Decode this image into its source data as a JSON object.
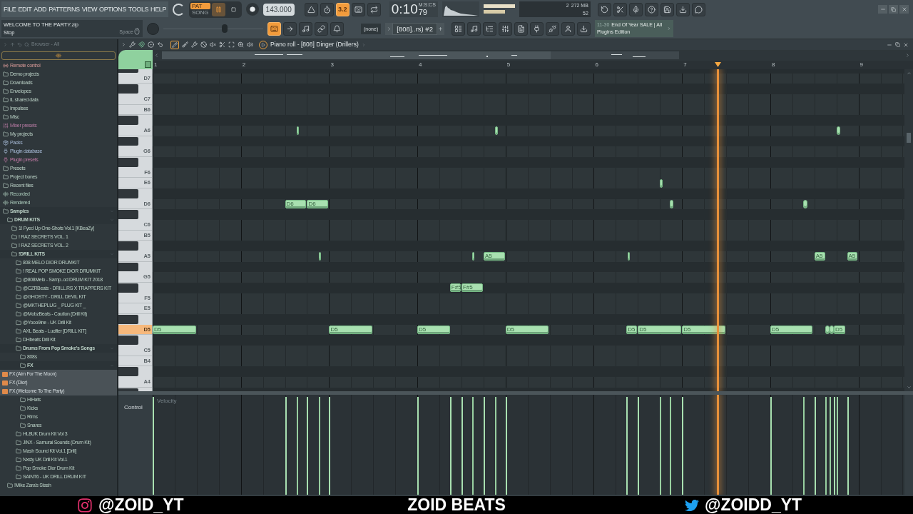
{
  "menu": [
    "FILE",
    "EDIT",
    "ADD",
    "PATTERNS",
    "VIEW",
    "OPTIONS",
    "TOOLS",
    "HELP"
  ],
  "modes": [
    {
      "label": "PAT",
      "selected": true
    },
    {
      "label": "SONG",
      "selected": false
    }
  ],
  "tempo": "143.000",
  "record_toggles": [
    {
      "on": false
    },
    {
      "on": false
    },
    {
      "on": true,
      "label": "3.2"
    },
    {
      "on": false
    },
    {
      "on": false
    }
  ],
  "time": {
    "value": "0:10",
    "centis": "79",
    "unit": "M:S:CS"
  },
  "stats": {
    "cpu": "2",
    "memory": "272 MB",
    "polyphony": "52"
  },
  "hint": {
    "title": "WELCOME TO THE PARTY.zip",
    "text": "Stop",
    "shortcut": "Space"
  },
  "master_pitch": {
    "level": 0.62
  },
  "edit_toggles": [
    {
      "on": true
    },
    {
      "on": false
    },
    {
      "on": false
    },
    {
      "on": false
    },
    {
      "on": false
    }
  ],
  "pattern_dropdown": "(none)",
  "pattern": "[808]..rs) #2",
  "news": {
    "date": "11-30",
    "text": "End Of Year SALE | All Plugins Edition"
  },
  "browser": {
    "title": "Browser - All",
    "items": [
      {
        "label": "Remote control",
        "kind": "remote"
      },
      {
        "label": "Demo projects",
        "kind": "folder",
        "expanded": false
      },
      {
        "label": "Downloads",
        "kind": "folder",
        "expanded": false
      },
      {
        "label": "Envelopes",
        "kind": "folder",
        "expanded": false
      },
      {
        "label": "IL shared data",
        "kind": "folder",
        "expanded": false
      },
      {
        "label": "Impulses",
        "kind": "folder",
        "expanded": false
      },
      {
        "label": "Misc",
        "kind": "folder",
        "expanded": false
      },
      {
        "label": "Mixer presets",
        "kind": "mixer"
      },
      {
        "label": "My projects",
        "kind": "folder",
        "expanded": false
      },
      {
        "label": "Packs",
        "kind": "packs"
      },
      {
        "label": "Plugin database",
        "kind": "plugin"
      },
      {
        "label": "Plugin presets",
        "kind": "presets"
      },
      {
        "label": "Presets",
        "kind": "folder",
        "expanded": false
      },
      {
        "label": "Project bones",
        "kind": "folder",
        "expanded": false
      },
      {
        "label": "Recent files",
        "kind": "folder",
        "expanded": false
      },
      {
        "label": "Recorded",
        "kind": "recorded"
      },
      {
        "label": "Rendered",
        "kind": "recorded"
      },
      {
        "label": "Samples",
        "kind": "folder",
        "expanded": true,
        "children": [
          {
            "label": "DRUM KITS",
            "kind": "folder",
            "expanded": true,
            "children": [
              {
                "label": "1! Fyed Up One-Shots Vol.1 [KBeaZy]",
                "kind": "folder",
                "expanded": false
              },
              {
                "label": "! RAZ SECRETS VOL. 1",
                "kind": "folder",
                "expanded": false
              },
              {
                "label": "! RAZ SECRETS VOL. 2",
                "kind": "folder",
                "expanded": false
              },
              {
                "label": "!DRILL KITS",
                "kind": "folder",
                "expanded": true,
                "children": [
                  {
                    "label": "808 MELO DIOR DRUMKIT",
                    "kind": "folder",
                    "expanded": false
                  },
                  {
                    "label": "! REAL POP SMOKE DIOR DRUMKIT",
                    "kind": "folder",
                    "expanded": false
                  },
                  {
                    "label": "@808Melo - Samp..od DRUM KIT 2018",
                    "kind": "folder",
                    "expanded": false
                  },
                  {
                    "label": "@CZRBeats - DRILL.RS X TRAPPERS KIT",
                    "kind": "folder",
                    "expanded": false
                  },
                  {
                    "label": "@GHOSTY - DRILL DEVIL KIT",
                    "kind": "folder",
                    "expanded": false
                  },
                  {
                    "label": "@MKTHEPLUG _ PLUG KIT _",
                    "kind": "folder",
                    "expanded": false
                  },
                  {
                    "label": "@MobzBeats - Caution (Drill Kit)",
                    "kind": "folder",
                    "expanded": false
                  },
                  {
                    "label": "@Yooo9ine - UK Drill Kit",
                    "kind": "folder",
                    "expanded": false
                  },
                  {
                    "label": "AXL Beats - Lucifier [DRILL KIT]",
                    "kind": "folder",
                    "expanded": false
                  },
                  {
                    "label": "DHbeats Drill Kit",
                    "kind": "folder",
                    "expanded": false
                  },
                  {
                    "label": "Drums From Pop Smoke's Songs",
                    "kind": "folder",
                    "expanded": true,
                    "children": [
                      {
                        "label": "808s",
                        "kind": "folder",
                        "expanded": false
                      },
                      {
                        "label": "FX",
                        "kind": "folder",
                        "expanded": true,
                        "children": [
                          {
                            "label": "FX (Aim For The Moon)",
                            "kind": "file"
                          },
                          {
                            "label": "FX (Dior)",
                            "kind": "file"
                          },
                          {
                            "label": "FX (Welcome To The Party)",
                            "kind": "file"
                          }
                        ]
                      },
                      {
                        "label": "HiHats",
                        "kind": "folder",
                        "expanded": false
                      },
                      {
                        "label": "Kicks",
                        "kind": "folder",
                        "expanded": false
                      },
                      {
                        "label": "Rims",
                        "kind": "folder",
                        "expanded": false
                      },
                      {
                        "label": "Snares",
                        "kind": "folder",
                        "expanded": false
                      }
                    ]
                  },
                  {
                    "label": "HL8UK Drum Kit Vol 3",
                    "kind": "folder",
                    "expanded": false
                  },
                  {
                    "label": "JiNX - Samurai Sounds (Drum Kit)",
                    "kind": "folder",
                    "expanded": false
                  },
                  {
                    "label": "Mash Sound Kit Vol.1 [Drill]",
                    "kind": "folder",
                    "expanded": false
                  },
                  {
                    "label": "Nxsty UK Drill Kit Vol.1",
                    "kind": "folder",
                    "expanded": false
                  },
                  {
                    "label": "Pop Smoke Dior Drum Kit",
                    "kind": "folder",
                    "expanded": false
                  },
                  {
                    "label": "SAINT6 - UK DRILL DRUM KIT",
                    "kind": "folder",
                    "expanded": false
                  }
                ]
              }
            ]
          },
          {
            "label": "!Mike Zara's Stash",
            "kind": "folder",
            "expanded": false
          }
        ]
      }
    ]
  },
  "piano_roll": {
    "title": "Piano roll - [808] Dinger (Drillers)",
    "bars": [
      "1",
      "2",
      "3",
      "4",
      "5",
      "6",
      "7",
      "8",
      "9"
    ],
    "keys": [
      {
        "label": "D7",
        "highlighted": false
      },
      {
        "label": "C7",
        "highlighted": false
      },
      {
        "label": "B6",
        "highlighted": false
      },
      {
        "label": "A6",
        "highlighted": false
      },
      {
        "label": "G6",
        "highlighted": false
      },
      {
        "label": "F6",
        "highlighted": false
      },
      {
        "label": "E6",
        "highlighted": false
      },
      {
        "label": "D6",
        "highlighted": false
      },
      {
        "label": "C6",
        "highlighted": false
      },
      {
        "label": "B5",
        "highlighted": false
      },
      {
        "label": "A5",
        "highlighted": false
      },
      {
        "label": "G5",
        "highlighted": false
      },
      {
        "label": "F5",
        "highlighted": false
      },
      {
        "label": "E5",
        "highlighted": false
      },
      {
        "label": "D5",
        "highlighted": true
      },
      {
        "label": "C5",
        "highlighted": false
      },
      {
        "label": "B4",
        "highlighted": false
      },
      {
        "label": "A4",
        "highlighted": false
      }
    ],
    "notes": [
      {
        "kind": "labelled",
        "label": "D5"
      },
      {
        "kind": "labelled",
        "label": "D6"
      },
      {
        "kind": "short"
      },
      {
        "kind": "labelled",
        "label": "D6"
      },
      {
        "kind": "short"
      },
      {
        "kind": "labelled",
        "label": "D5"
      },
      {
        "kind": "labelled",
        "label": "D5"
      },
      {
        "kind": "labelled",
        "label": "F#5"
      },
      {
        "kind": "labelled",
        "label": "F#5"
      },
      {
        "kind": "short"
      },
      {
        "kind": "labelled",
        "label": "A5"
      },
      {
        "kind": "short"
      },
      {
        "kind": "labelled",
        "label": "D5"
      },
      {
        "kind": "labelled",
        "label": "D5"
      },
      {
        "kind": "short"
      },
      {
        "kind": "labelled",
        "label": "D5"
      },
      {
        "kind": "short"
      },
      {
        "kind": "short"
      },
      {
        "kind": "labelled",
        "label": "D5"
      },
      {
        "kind": "labelled",
        "label": "D5"
      },
      {
        "kind": "short"
      },
      {
        "kind": "labelled",
        "label": "A5"
      },
      {
        "kind": "short"
      },
      {
        "kind": "short"
      },
      {
        "kind": "labelled",
        "label": "D5"
      },
      {
        "kind": "short"
      },
      {
        "kind": "labelled",
        "label": "A5"
      }
    ],
    "control_label": "Control",
    "control_hint": "Velocity"
  },
  "footer": {
    "left": "@ZOID_YT",
    "center": "ZOID BEATS",
    "right": "@ZOIDD_YT"
  }
}
